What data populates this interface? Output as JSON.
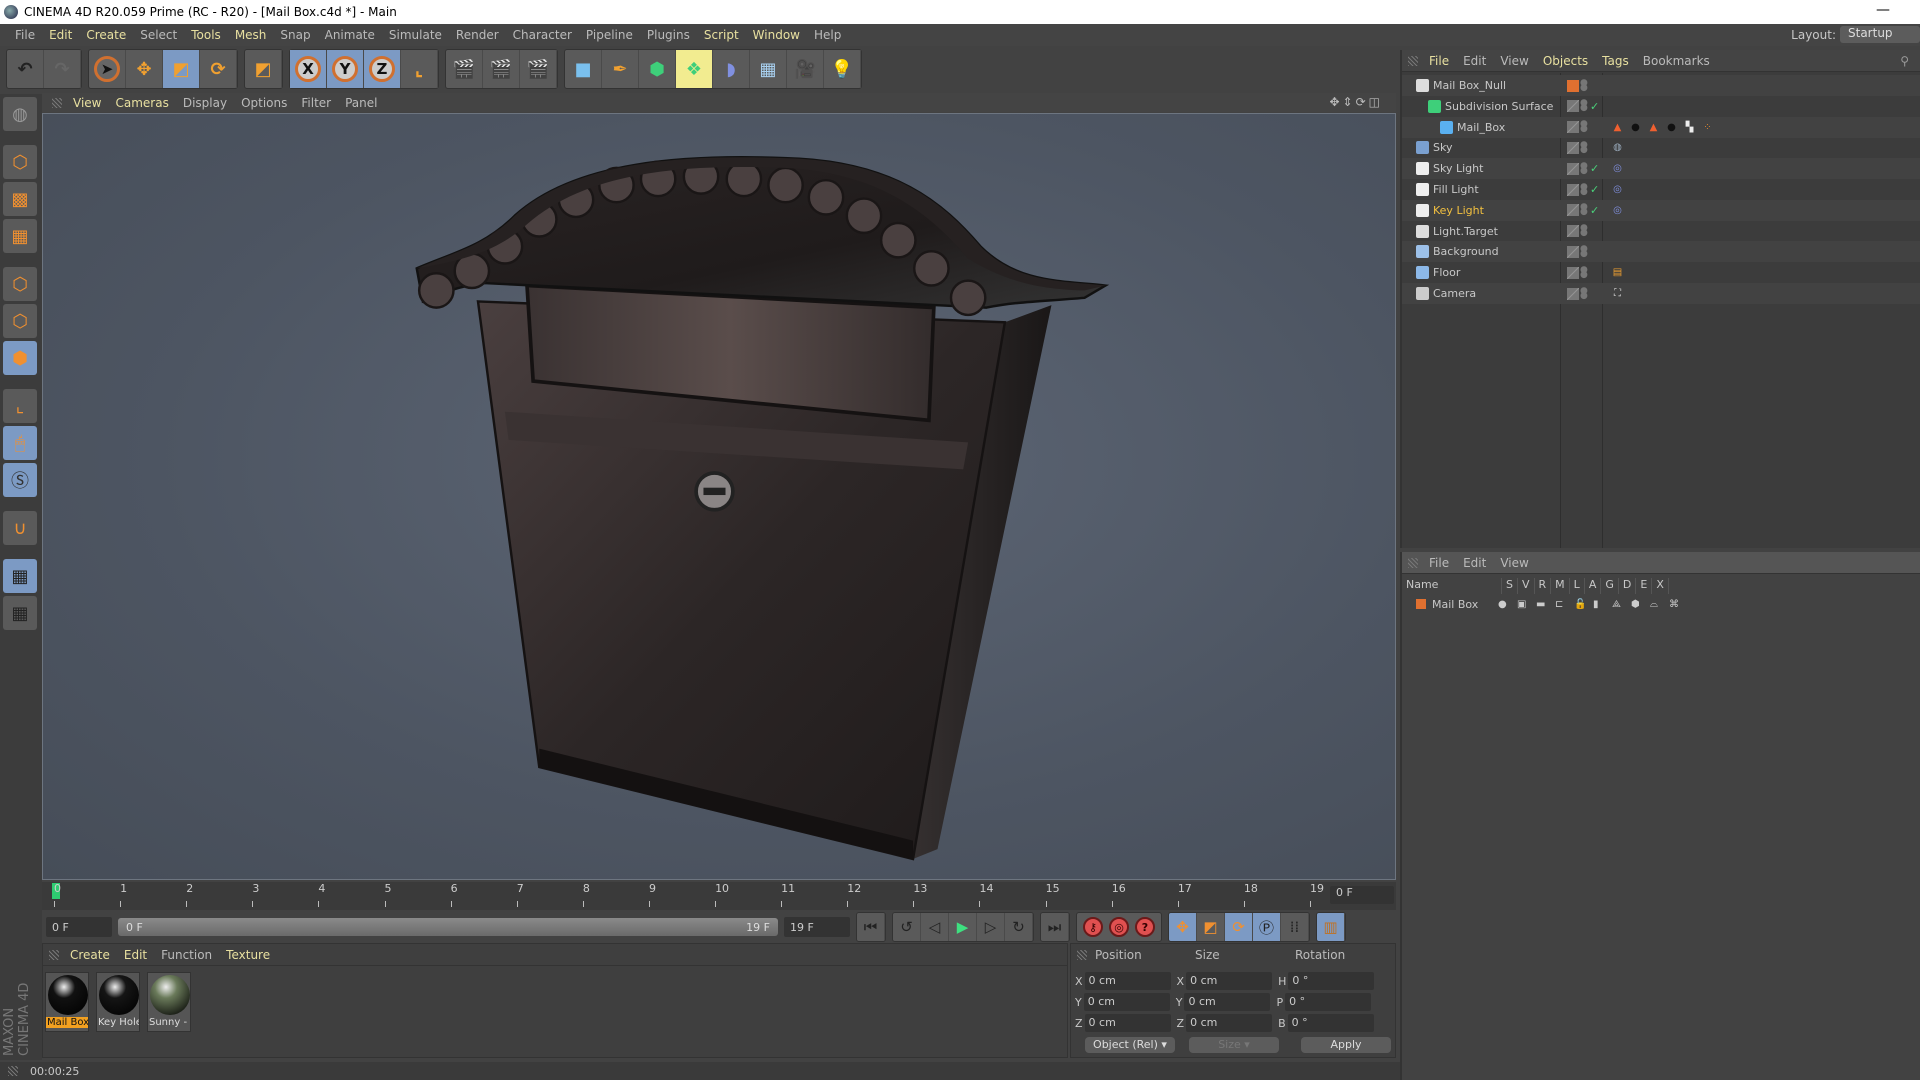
{
  "window": {
    "title": "CINEMA 4D R20.059 Prime (RC - R20) - [Mail Box.c4d *] - Main",
    "minimize": "—"
  },
  "menu": [
    {
      "label": "File",
      "hl": false
    },
    {
      "label": "Edit",
      "hl": true
    },
    {
      "label": "Create",
      "hl": true
    },
    {
      "label": "Select",
      "hl": false
    },
    {
      "label": "Tools",
      "hl": true
    },
    {
      "label": "Mesh",
      "hl": true
    },
    {
      "label": "Snap",
      "hl": false
    },
    {
      "label": "Animate",
      "hl": false
    },
    {
      "label": "Simulate",
      "hl": false
    },
    {
      "label": "Render",
      "hl": false
    },
    {
      "label": "Character",
      "hl": false
    },
    {
      "label": "Pipeline",
      "hl": false
    },
    {
      "label": "Plugins",
      "hl": false
    },
    {
      "label": "Script",
      "hl": true
    },
    {
      "label": "Window",
      "hl": true
    },
    {
      "label": "Help",
      "hl": false
    }
  ],
  "layout": {
    "label": "Layout:",
    "value": "Startup"
  },
  "toolbar": {
    "x": "X",
    "y": "Y",
    "z": "Z"
  },
  "viewport_menu": [
    {
      "label": "View",
      "hl": true
    },
    {
      "label": "Cameras",
      "hl": true
    },
    {
      "label": "Display",
      "hl": false
    },
    {
      "label": "Options",
      "hl": false
    },
    {
      "label": "Filter",
      "hl": false
    },
    {
      "label": "Panel",
      "hl": false
    }
  ],
  "timeline": {
    "ticks": [
      "0",
      "1",
      "2",
      "3",
      "4",
      "5",
      "6",
      "7",
      "8",
      "9",
      "10",
      "11",
      "12",
      "13",
      "14",
      "15",
      "16",
      "17",
      "18",
      "19"
    ],
    "current_frame": "0 F",
    "start_field": "0 F",
    "range_start": "0 F",
    "range_end": "19 F",
    "end_field": "19 F",
    "playhead_frame": 0
  },
  "material_manager": {
    "menu": [
      {
        "label": "Create",
        "hl": true
      },
      {
        "label": "Edit",
        "hl": true
      },
      {
        "label": "Function",
        "hl": false
      },
      {
        "label": "Texture",
        "hl": true
      }
    ],
    "materials": [
      {
        "label": "Mail Box",
        "selected": true,
        "color": "#111111"
      },
      {
        "label": "Key Hole",
        "selected": false,
        "color": "#151515"
      },
      {
        "label": "Sunny -",
        "selected": false,
        "color": "#6a7a5a"
      }
    ]
  },
  "coordinates": {
    "headers": {
      "position": "Position",
      "size": "Size",
      "rotation": "Rotation"
    },
    "rows": [
      {
        "pl": "X",
        "pv": "0 cm",
        "sl": "X",
        "sv": "0 cm",
        "rl": "H",
        "rv": "0 °"
      },
      {
        "pl": "Y",
        "pv": "0 cm",
        "sl": "Y",
        "sv": "0 cm",
        "rl": "P",
        "rv": "0 °"
      },
      {
        "pl": "Z",
        "pv": "0 cm",
        "sl": "Z",
        "sv": "0 cm",
        "rl": "B",
        "rv": "0 °"
      }
    ],
    "mode": "Object (Rel)",
    "size_mode": "Size",
    "apply": "Apply"
  },
  "logo": "MAXON CINEMA 4D",
  "status": {
    "time": "00:00:25"
  },
  "object_manager": {
    "menu": [
      {
        "label": "File",
        "hl": true
      },
      {
        "label": "Edit",
        "hl": false
      },
      {
        "label": "View",
        "hl": false
      },
      {
        "label": "Objects",
        "hl": true
      },
      {
        "label": "Tags",
        "hl": true
      },
      {
        "label": "Bookmarks",
        "hl": false
      }
    ],
    "objects": [
      {
        "name": "Mail Box_Null",
        "level": 0,
        "icon": "null-icon",
        "active": false,
        "check": false
      },
      {
        "name": "Subdivision Surface",
        "level": 1,
        "icon": "subdivision-icon",
        "active": false,
        "check": true
      },
      {
        "name": "Mail_Box",
        "level": 2,
        "icon": "polygon-object-icon",
        "active": false,
        "check": false
      },
      {
        "name": "Sky",
        "level": 0,
        "icon": "sky-icon",
        "active": false,
        "check": false
      },
      {
        "name": "Sky Light",
        "level": 0,
        "icon": "light-icon",
        "active": false,
        "check": true
      },
      {
        "name": "Fill Light",
        "level": 0,
        "icon": "light-icon",
        "active": false,
        "check": true
      },
      {
        "name": "Key Light",
        "level": 0,
        "icon": "light-icon",
        "active": true,
        "check": true
      },
      {
        "name": "Light.Target",
        "level": 0,
        "icon": "null-icon",
        "active": false,
        "check": false
      },
      {
        "name": "Background",
        "level": 0,
        "icon": "background-icon",
        "active": false,
        "check": false
      },
      {
        "name": "Floor",
        "level": 0,
        "icon": "floor-icon",
        "active": false,
        "check": false
      },
      {
        "name": "Camera",
        "level": 0,
        "icon": "camera-icon",
        "active": false,
        "check": false
      }
    ],
    "active_color": "#f2c040"
  },
  "layer_manager": {
    "menu": [
      {
        "label": "File",
        "hl": false
      },
      {
        "label": "Edit",
        "hl": false
      },
      {
        "label": "View",
        "hl": false
      }
    ],
    "columns": [
      "Name",
      "S",
      "V",
      "R",
      "M",
      "L",
      "A",
      "G",
      "D",
      "E",
      "X"
    ],
    "layers": [
      {
        "name": "Mail Box",
        "color": "#e07030"
      }
    ]
  }
}
